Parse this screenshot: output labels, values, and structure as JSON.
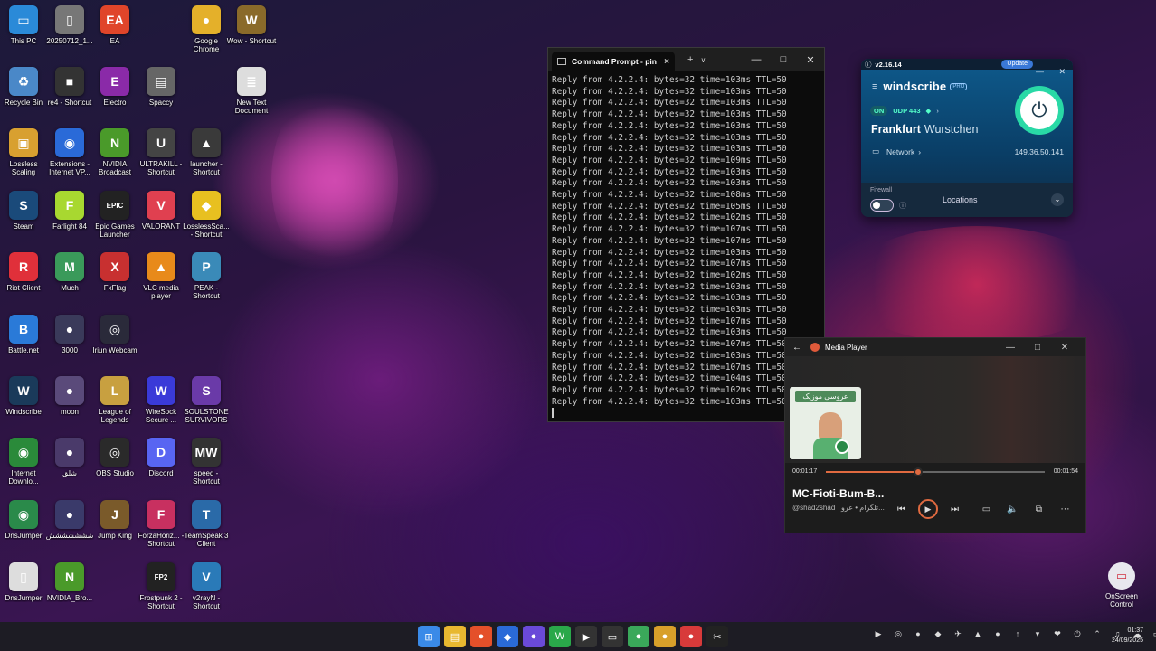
{
  "desktop_icons": [
    {
      "label": "This PC",
      "glyph": "▭",
      "color": "#2a8ad8"
    },
    {
      "label": "20250712_1...",
      "glyph": "▯",
      "color": "#777"
    },
    {
      "label": "EA",
      "glyph": "EA",
      "color": "#e0452a"
    },
    {
      "label": "Google Chrome",
      "glyph": "●",
      "color": "#e4b02a"
    },
    {
      "label": "Wow - Shortcut",
      "glyph": "W",
      "color": "#8a6a2a"
    },
    {
      "label": "Recycle Bin",
      "glyph": "♻",
      "color": "#4a88c8"
    },
    {
      "label": "re4 - Shortcut",
      "glyph": "■",
      "color": "#333"
    },
    {
      "label": "Electro",
      "glyph": "E",
      "color": "#8a2aa8"
    },
    {
      "label": "Spaccy",
      "glyph": "▤",
      "color": "#666"
    },
    {
      "label": "New Text Document",
      "glyph": "≣",
      "color": "#ddd"
    },
    {
      "label": "Lossless Scaling",
      "glyph": "▣",
      "color": "#d8a030"
    },
    {
      "label": "Extensions - Internet VP...",
      "glyph": "◉",
      "color": "#2a6ad8"
    },
    {
      "label": "NVIDIA Broadcast",
      "glyph": "N",
      "color": "#4a9a2a"
    },
    {
      "label": "ULTRAKILL - Shortcut",
      "glyph": "U",
      "color": "#444"
    },
    {
      "label": "launcher - Shortcut",
      "glyph": "▲",
      "color": "#3a3a3a"
    },
    {
      "label": "Steam",
      "glyph": "S",
      "color": "#1a4a7a"
    },
    {
      "label": "Farlight 84",
      "glyph": "F",
      "color": "#a8d830"
    },
    {
      "label": "Epic Games Launcher",
      "glyph": "EPIC",
      "color": "#222"
    },
    {
      "label": "VALORANT",
      "glyph": "V",
      "color": "#e04050"
    },
    {
      "label": "LosslessSca... - Shortcut",
      "glyph": "◆",
      "color": "#e8c020"
    },
    {
      "label": "Riot Client",
      "glyph": "R",
      "color": "#e0303a"
    },
    {
      "label": "Much",
      "glyph": "M",
      "color": "#3a9a5a"
    },
    {
      "label": "FxFlag",
      "glyph": "X",
      "color": "#c83030"
    },
    {
      "label": "VLC media player",
      "glyph": "▲",
      "color": "#e88a1a"
    },
    {
      "label": "PEAK - Shortcut",
      "glyph": "P",
      "color": "#3a8ab8"
    },
    {
      "label": "Battle.net",
      "glyph": "B",
      "color": "#2a7ad8"
    },
    {
      "label": "3000",
      "glyph": "●",
      "color": "#3a3a5a"
    },
    {
      "label": "Iriun Webcam",
      "glyph": "◎",
      "color": "#2a2a3a"
    },
    {
      "label": "Windscribe",
      "glyph": "W",
      "color": "#1a3a5a"
    },
    {
      "label": "moon",
      "glyph": "●",
      "color": "#5a4a7a"
    },
    {
      "label": "League of Legends",
      "glyph": "L",
      "color": "#c8a040"
    },
    {
      "label": "WireSock Secure ...",
      "glyph": "W",
      "color": "#3a3ad8"
    },
    {
      "label": "SOULSTONE SURVIVORS",
      "glyph": "S",
      "color": "#6a3aa8"
    },
    {
      "label": "Internet Downlo...",
      "glyph": "◉",
      "color": "#2a8a3a"
    },
    {
      "label": "شلق",
      "glyph": "●",
      "color": "#4a3a6a"
    },
    {
      "label": "OBS Studio",
      "glyph": "◎",
      "color": "#2a2a2a"
    },
    {
      "label": "Discord",
      "glyph": "D",
      "color": "#5865f2"
    },
    {
      "label": "speed - Shortcut",
      "glyph": "MW",
      "color": "#333"
    },
    {
      "label": "DnsJumper",
      "glyph": "◉",
      "color": "#2a8a4a"
    },
    {
      "label": "ششششششش",
      "glyph": "●",
      "color": "#3a3a6a"
    },
    {
      "label": "Jump King",
      "glyph": "J",
      "color": "#7a5a2a"
    },
    {
      "label": "ForzaHoriz... - Shortcut",
      "glyph": "F",
      "color": "#c83060"
    },
    {
      "label": "TeamSpeak 3 Client",
      "glyph": "T",
      "color": "#2a6aa8"
    },
    {
      "label": "DnsJumper",
      "glyph": "▯",
      "color": "#ddd"
    },
    {
      "label": "NVIDIA_Bro...",
      "glyph": "N",
      "color": "#4a9a2a"
    },
    {
      "label": "Frostpunk 2 - Shortcut",
      "glyph": "FP2",
      "color": "#222"
    },
    {
      "label": "v2rayN - Shortcut",
      "glyph": "V",
      "color": "#2a7ab8"
    }
  ],
  "cmd": {
    "tab_title": "Command Prompt - pin",
    "new_tab": "+",
    "dropdown": "∨",
    "lines": [
      "Reply from 4.2.2.4: bytes=32 time=103ms TTL=50",
      "Reply from 4.2.2.4: bytes=32 time=103ms TTL=50",
      "Reply from 4.2.2.4: bytes=32 time=103ms TTL=50",
      "Reply from 4.2.2.4: bytes=32 time=103ms TTL=50",
      "Reply from 4.2.2.4: bytes=32 time=103ms TTL=50",
      "Reply from 4.2.2.4: bytes=32 time=103ms TTL=50",
      "Reply from 4.2.2.4: bytes=32 time=103ms TTL=50",
      "Reply from 4.2.2.4: bytes=32 time=109ms TTL=50",
      "Reply from 4.2.2.4: bytes=32 time=103ms TTL=50",
      "Reply from 4.2.2.4: bytes=32 time=103ms TTL=50",
      "Reply from 4.2.2.4: bytes=32 time=108ms TTL=50",
      "Reply from 4.2.2.4: bytes=32 time=105ms TTL=50",
      "Reply from 4.2.2.4: bytes=32 time=102ms TTL=50",
      "Reply from 4.2.2.4: bytes=32 time=107ms TTL=50",
      "Reply from 4.2.2.4: bytes=32 time=107ms TTL=50",
      "Reply from 4.2.2.4: bytes=32 time=103ms TTL=50",
      "Reply from 4.2.2.4: bytes=32 time=107ms TTL=50",
      "Reply from 4.2.2.4: bytes=32 time=102ms TTL=50",
      "Reply from 4.2.2.4: bytes=32 time=103ms TTL=50",
      "Reply from 4.2.2.4: bytes=32 time=103ms TTL=50",
      "Reply from 4.2.2.4: bytes=32 time=103ms TTL=50",
      "Reply from 4.2.2.4: bytes=32 time=107ms TTL=50",
      "Reply from 4.2.2.4: bytes=32 time=103ms TTL=50",
      "Reply from 4.2.2.4: bytes=32 time=107ms TTL=50",
      "Reply from 4.2.2.4: bytes=32 time=103ms TTL=50",
      "Reply from 4.2.2.4: bytes=32 time=107ms TTL=50",
      "Reply from 4.2.2.4: bytes=32 time=104ms TTL=50",
      "Reply from 4.2.2.4: bytes=32 time=102ms TTL=50",
      "Reply from 4.2.2.4: bytes=32 time=103ms TTL=50"
    ]
  },
  "windscribe": {
    "version": "v2.16.14",
    "update_label": "Update",
    "brand": "windscribe",
    "pro": "PRO",
    "status": "ON",
    "protocol": "UDP 443",
    "city": "Frankfurt",
    "nickname": "Wurstchen",
    "network_label": "Network",
    "ip": "149.36.50.141",
    "firewall_label": "Firewall",
    "locations_label": "Locations"
  },
  "media_player": {
    "title": "Media Player",
    "album_text": "عروسی موزیک",
    "elapsed": "00:01:17",
    "total": "00:01:54",
    "progress": 0.42,
    "song": "MC-Fioti-Bum-B...",
    "artist": "@shad2shad   تلگرام • عرو..."
  },
  "onscreen_control": {
    "label": "OnScreen Control"
  },
  "taskbar": {
    "apps": [
      {
        "name": "start-icon",
        "glyph": "⊞",
        "color": "#3a8ae8"
      },
      {
        "name": "file-explorer-icon",
        "glyph": "▤",
        "color": "#e8b830"
      },
      {
        "name": "chrome-icon",
        "glyph": "●",
        "color": "#e4502a"
      },
      {
        "name": "app-icon",
        "glyph": "◆",
        "color": "#2a6ad8"
      },
      {
        "name": "messenger-icon",
        "glyph": "●",
        "color": "#6a4ad8"
      },
      {
        "name": "whatsapp-icon",
        "glyph": "W",
        "color": "#2aa84a"
      },
      {
        "name": "media-player-icon",
        "glyph": "▶",
        "color": "#333"
      },
      {
        "name": "terminal-icon",
        "glyph": "▭",
        "color": "#333"
      },
      {
        "name": "chrome-alt-icon",
        "glyph": "●",
        "color": "#3aa85a"
      },
      {
        "name": "chrome-beta-icon",
        "glyph": "●",
        "color": "#d8a02a"
      },
      {
        "name": "browser-icon",
        "glyph": "●",
        "color": "#d83a3a"
      },
      {
        "name": "capcut-icon",
        "glyph": "✂",
        "color": "#222"
      }
    ],
    "tray": [
      "▶",
      "◎",
      "●",
      "◆",
      "✈",
      "▲",
      "●",
      "↑",
      "▾",
      "❤",
      "⏻",
      "⌃",
      "♫",
      "☁",
      "▭",
      "♪"
    ],
    "time": "01:37",
    "date": "24/09/2025"
  }
}
